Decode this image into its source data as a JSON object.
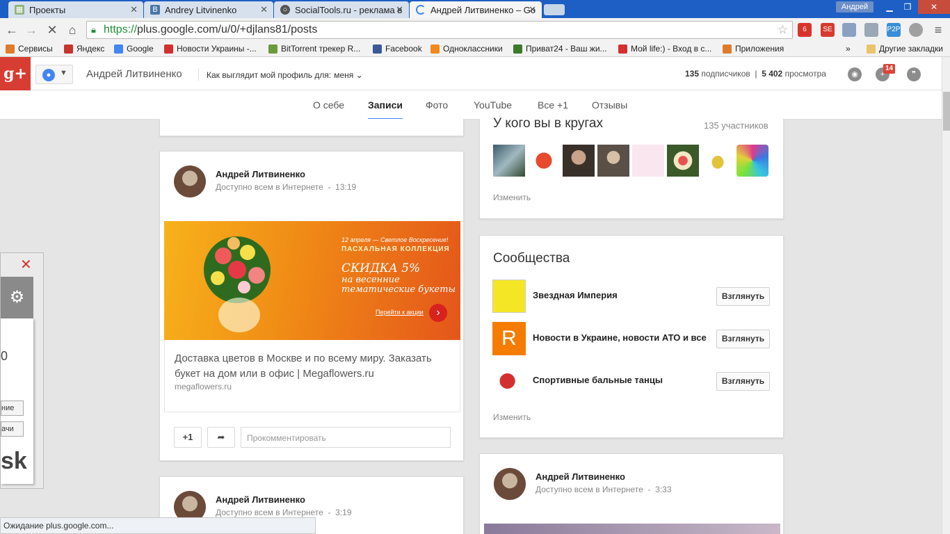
{
  "browser": {
    "tabs": [
      {
        "title": "Проекты",
        "active": false
      },
      {
        "title": "Andrey Litvinenko",
        "active": false
      },
      {
        "title": "SocialTools.ru - реклама в",
        "active": false
      },
      {
        "title": "Андрей Литвиненко – Go",
        "active": true
      }
    ],
    "profile_user": "Андрей",
    "url_scheme": "https://",
    "url_rest": "plus.google.com/u/0/+djlans81/posts",
    "extensions": [
      {
        "label": "6",
        "color": "#d9342b"
      },
      {
        "label": "SE",
        "color": "#d63b2e"
      },
      {
        "label": "",
        "color": "#8aa1c1"
      },
      {
        "label": "",
        "color": "#9aa8b5"
      },
      {
        "label": "P2P",
        "color": "#3a8fd6"
      },
      {
        "label": "",
        "color": "#a0a0a0"
      }
    ],
    "bookmarks": [
      {
        "label": "Сервисы",
        "color": "#e07b2b"
      },
      {
        "label": "Яндекс",
        "color": "#c7342b"
      },
      {
        "label": "Google",
        "color": "#4285f4"
      },
      {
        "label": "Новости Украины -...",
        "color": "#d32f2f"
      },
      {
        "label": "BitTorrent трекер R...",
        "color": "#6a9a3a"
      },
      {
        "label": "Facebook",
        "color": "#3b5998"
      },
      {
        "label": "Одноклассники",
        "color": "#f2891f"
      },
      {
        "label": "Приват24 - Ваш жи...",
        "color": "#3b7a2a"
      },
      {
        "label": "Мой life:) - Вход в с...",
        "color": "#d32f2f"
      },
      {
        "label": "Приложения",
        "color": "#e07b2b"
      }
    ],
    "bookmarks_more": "»",
    "other_bookmarks": "Другие закладки",
    "status_text": "Ожидание plus.google.com..."
  },
  "header": {
    "logo": "g+",
    "name": "Андрей Литвиненко",
    "view_as_label": "Как выглядит мой профиль для:",
    "view_as_value": "меня",
    "followers": "135",
    "followers_label": "подписчиков",
    "views": "5 402",
    "views_label": "просмотра",
    "notif_count": "14"
  },
  "profile_tabs": [
    "О себе",
    "Записи",
    "Фото",
    "YouTube",
    "Все +1",
    "Отзывы"
  ],
  "active_tab_index": 1,
  "post1": {
    "author": "Андрей Литвиненко",
    "visibility": "Доступно всем в Интернете",
    "time": "13:19",
    "banner": {
      "line1": "12 апреля — Светлое Воскресение!",
      "line2": "ПАСХАЛЬНАЯ КОЛЛЕКЦИЯ",
      "line3": "СКИДКА 5%",
      "line4": "на весенние тематические букеты",
      "cta": "Перейти к акции"
    },
    "link_title": "Доставка цветов в Москве и по всему миру. Заказать букет на дом или в офис | Megaflowers.ru",
    "link_url": "megaflowers.ru",
    "plus_one": "+1",
    "comment_placeholder": "Прокомментировать"
  },
  "post2": {
    "author": "Андрей Литвиненко",
    "visibility": "Доступно всем в Интернете",
    "time": "3:19"
  },
  "post3": {
    "author": "Андрей Литвиненко",
    "visibility": "Доступно всем в Интернете",
    "time": "3:33"
  },
  "circles": {
    "title": "У кого вы в кругах",
    "count": "135 участников",
    "edit": "Изменить",
    "thumb_colors": [
      "#3d5a6b",
      "#e9e9e9",
      "#4a3c35",
      "#8e8070",
      "#f3d3e3",
      "#5a6a35",
      "#e8e3c5",
      "#2a4aa0"
    ]
  },
  "communities": {
    "title": "Сообщества",
    "items": [
      {
        "name": "Звездная Империя",
        "button": "Взглянуть",
        "color": "#f5e625"
      },
      {
        "name": "Новости в Украине, новости АТО и все",
        "button": "Взглянуть",
        "color": "#f57c00"
      },
      {
        "name": "Спортивные бальные танцы",
        "button": "Взглянуть",
        "color": "#ffffff"
      }
    ],
    "edit": "Изменить"
  },
  "widget": {
    "number": "0",
    "btn1": "ние",
    "btn2": "ачи",
    "big": "sk"
  }
}
